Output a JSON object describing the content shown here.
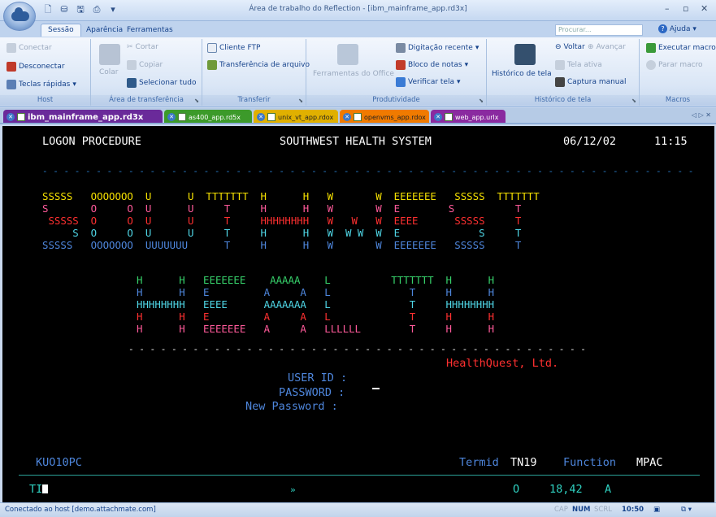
{
  "window": {
    "title": "Área de trabalho do Reflection - [ibm_mainframe_app.rd3x]",
    "min": "–",
    "max": "▫",
    "close": "✕"
  },
  "qat_icons": [
    "new-doc-icon",
    "open-icon",
    "save-icon",
    "print-icon",
    "quick-access-icon"
  ],
  "ribbon_tabs": [
    {
      "label": "Sessão",
      "active": true
    },
    {
      "label": "Aparência",
      "active": false
    },
    {
      "label": "Ferramentas",
      "active": false
    }
  ],
  "search_placeholder": "Procurar...",
  "help_label": "Ajuda",
  "groups": {
    "host": {
      "label": "Host",
      "items": [
        "Conectar",
        "Desconectar",
        "Teclas rápidas"
      ]
    },
    "clipboard": {
      "label": "Área de transferência",
      "paste": "Colar",
      "items": [
        "Cortar",
        "Copiar",
        "Selecionar tudo"
      ]
    },
    "transfer": {
      "label": "Transferir",
      "items": [
        "Cliente FTP",
        "Transferência de arquivo"
      ]
    },
    "productivity": {
      "label": "Produtividade",
      "office": "Ferramentas do Office",
      "items": [
        "Digitação recente",
        "Bloco de notas",
        "Verificar tela"
      ]
    },
    "screen_history": {
      "label": "Histórico de tela",
      "big": "Histórico de tela",
      "back": "Voltar",
      "forward": "Avançar",
      "active": "Tela ativa",
      "capture": "Captura manual"
    },
    "macros": {
      "label": "Macros",
      "run": "Executar macro",
      "stop": "Parar macro"
    }
  },
  "doc_tabs": [
    {
      "label": "ibm_mainframe_app.rd3x",
      "color": "#6a2a9a",
      "active": true
    },
    {
      "label": "as400_app.rd5x",
      "color": "#3c9a2a",
      "active": false
    },
    {
      "label": "unix_vt_app.rdox",
      "color": "#e0b000",
      "active": false
    },
    {
      "label": "openvms_app.rdox",
      "color": "#f07a00",
      "active": false
    },
    {
      "label": "web_app.urlx",
      "color": "#8a2aa0",
      "active": false
    }
  ],
  "tab_nav": "◁ ▷ ✕",
  "terminal": {
    "header_left": "LOGON PROCEDURE",
    "header_center": "SOUTHWEST HEALTH SYSTEM",
    "date": "06/12/02",
    "time": "11:15",
    "dash_line": "- - - - - - - - - - - - - - - - - - - - - - - - - - - - - - - - - - - - - - - - - - - - - - - - - - - - - - - - - - - - - - - -",
    "banner1": [
      {
        "text": "SSSSS   OOOOOOO  U      U  TTTTTTT  H      H   W       W  EEEEEEE   SSSSS  TTTTTTT",
        "color": "#f5e000"
      },
      {
        "text": "S       O     O  U      U     T     H      H   W       W  E        S          T   ",
        "color": "#ff5a9a"
      },
      {
        "text": " SSSSS  O     O  U      U     T     HHHHHHHH   W   W   W  EEEE      SSSSS     T   ",
        "color": "#ff3030"
      },
      {
        "text": "     S  O     O  U      U     T     H      H   W  W W  W  E             S     T   ",
        "color": "#4fd6e6"
      },
      {
        "text": "SSSSS   OOOOOOO  UUUUUUU      T     H      H   W       W  EEEEEEE   SSSSS     T   ",
        "color": "#4e86dc"
      }
    ],
    "banner2": [
      {
        "text": "H      H   EEEEEEE    AAAAA    L          TTTTTTT  H      H",
        "color": "#37d26b"
      },
      {
        "text": "H      H   E         A     A   L             T     H      H",
        "color": "#4e86dc"
      },
      {
        "text": "HHHHHHHH   EEEE      AAAAAAA   L             T     HHHHHHHH",
        "color": "#4fd6e6"
      },
      {
        "text": "H      H   E         A     A   L             T     H      H",
        "color": "#ff3030"
      },
      {
        "text": "H      H   EEEEEEE   A     A   LLLLLL        T     H      H",
        "color": "#ff5a9a"
      }
    ],
    "company": "HealthQuest, Ltd.",
    "user_id_label": "USER ID :",
    "password_label": "PASSWORD :",
    "new_password_label": "New Password :",
    "screen_id": "KUO10PC",
    "termid_label": "Termid",
    "termid_value": "TN19",
    "function_label": "Function",
    "function_value": "MPAC",
    "oia_left": "TI",
    "oia_arrow": "»",
    "oia_o": "O",
    "oia_pos": "18,42",
    "oia_a": "A"
  },
  "status": {
    "connection": "Conectado ao host [demo.attachmate.com]",
    "cap": "CAP",
    "num": "NUM",
    "scrl": "SCRL",
    "time": "10:50"
  }
}
